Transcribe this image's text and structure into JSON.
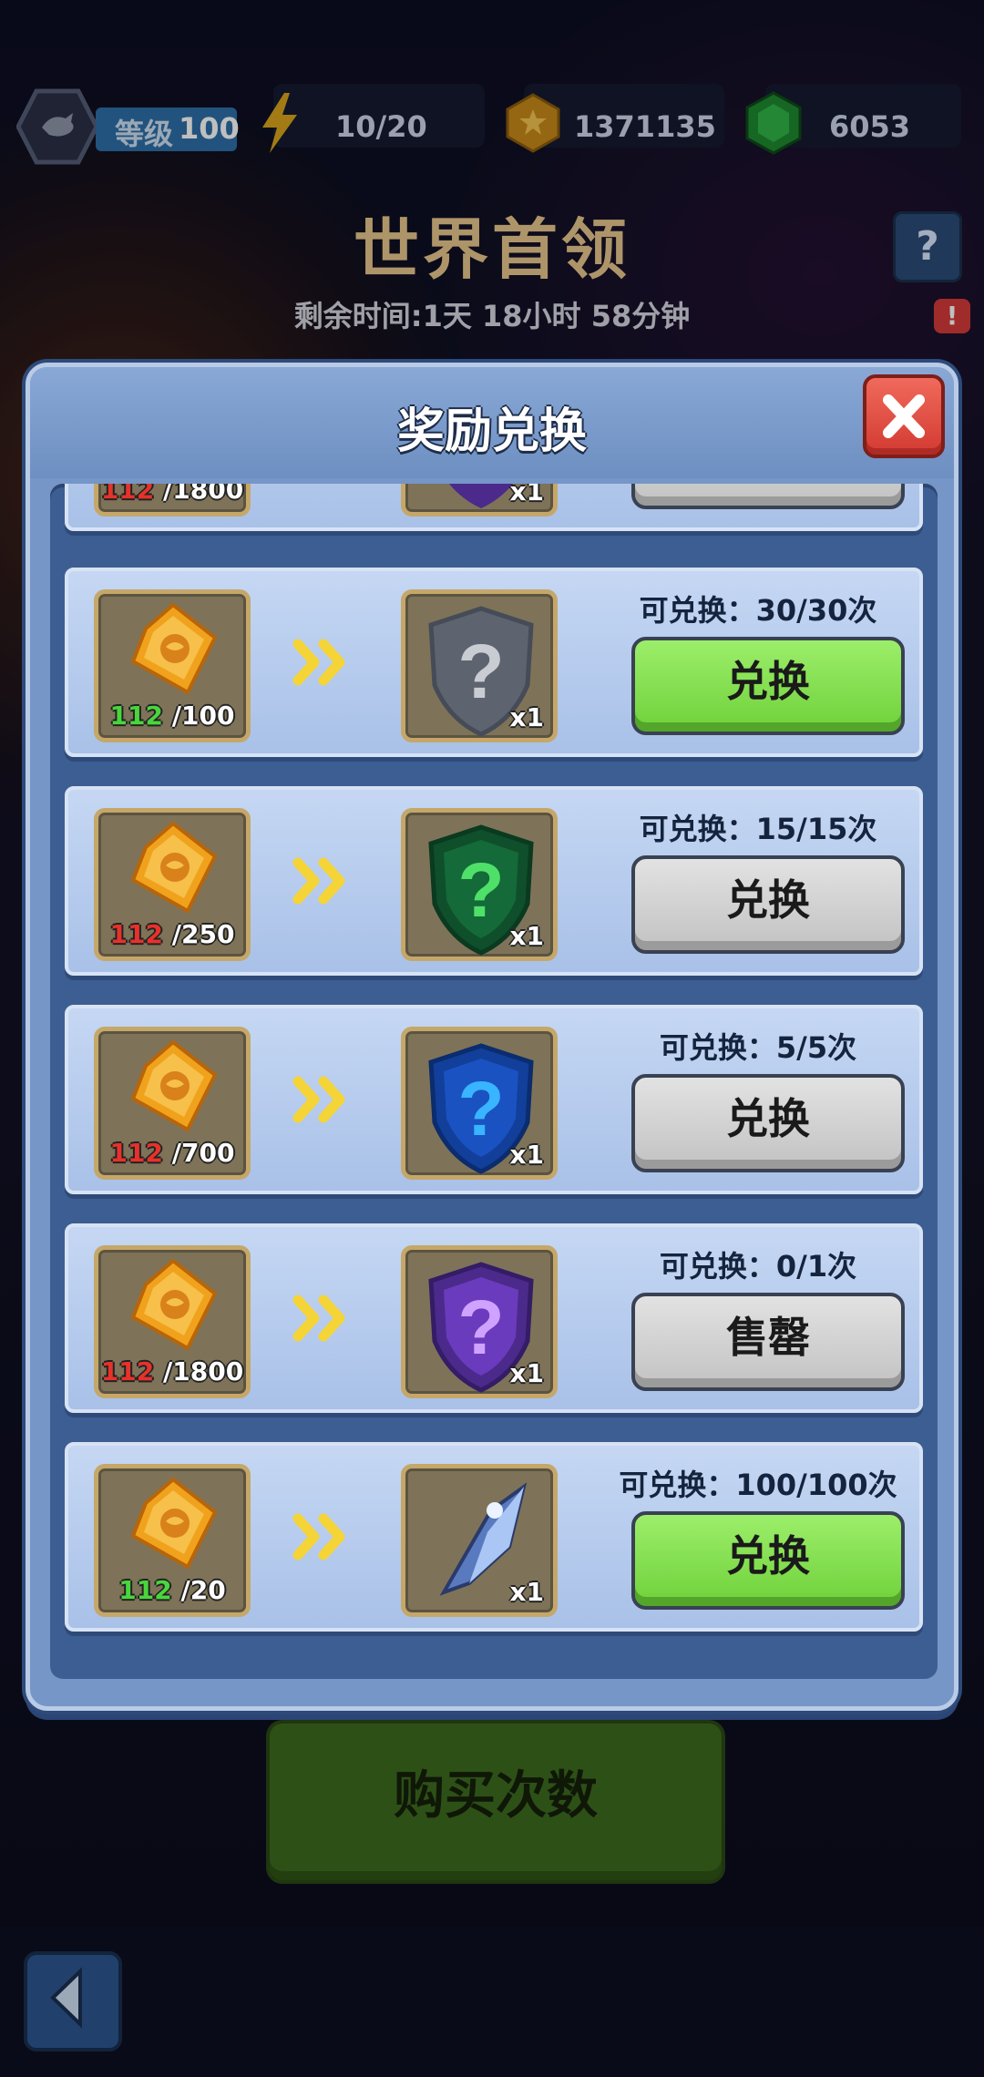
{
  "hud": {
    "level_label": "等级",
    "level_value": "100",
    "energy": "10/20",
    "gold": "1371135",
    "gems": "6053"
  },
  "event": {
    "title": "世界首领",
    "remaining_label": "剩余时间:",
    "remaining_days": "1天",
    "remaining_hours": "18小时",
    "remaining_minutes": "58分钟",
    "help_symbol": "?",
    "alert_symbol": "!"
  },
  "modal": {
    "title": "奖励兑换",
    "partial_row": {
      "cost_have": "112",
      "cost_need": "/1800",
      "qty": "x1"
    },
    "rows": [
      {
        "cost_have": "112",
        "cost_have_status": "green",
        "cost_need": "/100",
        "reward": "gray-shield",
        "qty": "x1",
        "avail_label": "可兑换：",
        "avail": "30/30次",
        "button": "兑换",
        "button_state": "green"
      },
      {
        "cost_have": "112",
        "cost_have_status": "red",
        "cost_need": "/250",
        "reward": "green-shield",
        "qty": "x1",
        "avail_label": "可兑换：",
        "avail": "15/15次",
        "button": "兑换",
        "button_state": "gray"
      },
      {
        "cost_have": "112",
        "cost_have_status": "red",
        "cost_need": "/700",
        "reward": "blue-shield",
        "qty": "x1",
        "avail_label": "可兑换：",
        "avail": "5/5次",
        "button": "兑换",
        "button_state": "gray"
      },
      {
        "cost_have": "112",
        "cost_have_status": "red",
        "cost_need": "/1800",
        "reward": "purple-shield",
        "qty": "x1",
        "avail_label": "可兑换：",
        "avail": "0/1次",
        "button": "售罄",
        "button_state": "gray"
      },
      {
        "cost_have": "112",
        "cost_have_status": "green",
        "cost_need": "/20",
        "reward": "crystal-shard",
        "qty": "x1",
        "avail_label": "可兑换：",
        "avail": "100/100次",
        "button": "兑换",
        "button_state": "green"
      }
    ]
  },
  "footer": {
    "buy_button": "购买次数"
  },
  "colors": {
    "shield_gray": "#5d6470",
    "shield_green": "#0f4f2b",
    "shield_blue": "#113f9a",
    "shield_purple": "#4b2a8c"
  }
}
